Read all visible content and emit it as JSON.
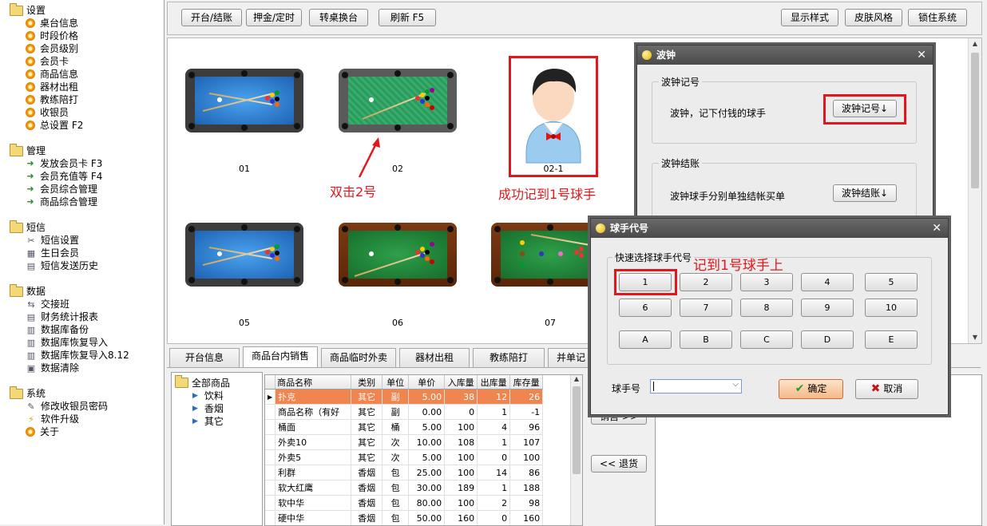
{
  "sidebar": {
    "groups": [
      {
        "label": "设置",
        "items": [
          "桌台信息",
          "时段价格",
          "会员级别",
          "会员卡",
          "商品信息",
          "器材出租",
          "教练陪打",
          "收银员",
          "总设置 F2"
        ]
      },
      {
        "label": "管理",
        "items": [
          "发放会员卡 F3",
          "会员充值等 F4",
          "会员综合管理",
          "商品综合管理"
        ]
      },
      {
        "label": "短信",
        "items": [
          "短信设置",
          "生日会员",
          "短信发送历史"
        ]
      },
      {
        "label": "数据",
        "items": [
          "交接班",
          "财务统计报表",
          "数据库备份",
          "数据库恢复导入",
          "数据库恢复导入8.12",
          "数据清除"
        ]
      },
      {
        "label": "系统",
        "items": [
          "修改收银员密码",
          "软件升级",
          "关于"
        ]
      }
    ]
  },
  "toolbar": {
    "open_close": "开台/结账",
    "deposit_timer": "押金/定时",
    "change_table": "转桌换台",
    "refresh": "刷新 F5",
    "display_style": "显示样式",
    "skin_style": "皮肤风格",
    "lock_system": "锁住系统"
  },
  "tables": [
    {
      "label": "01"
    },
    {
      "label": "02"
    },
    {
      "label": "02-1"
    },
    {
      "label": "05"
    },
    {
      "label": "06"
    },
    {
      "label": "07"
    }
  ],
  "annotations": {
    "double_click": "双击2号",
    "success": "成功记到1号球手",
    "record_to": "记到1号球手上"
  },
  "tabs": [
    "开台信息",
    "商品台内销售",
    "商品临时外卖",
    "器材出租",
    "教练陪打",
    "并单记"
  ],
  "category_tree": {
    "root": "全部商品",
    "children": [
      "饮料",
      "香烟",
      "其它"
    ]
  },
  "goods_table": {
    "columns": [
      "商品名称",
      "类别",
      "单位",
      "单价",
      "入库量",
      "出库量",
      "库存量"
    ],
    "rows": [
      [
        "扑克",
        "其它",
        "副",
        "5.00",
        "38",
        "12",
        "26"
      ],
      [
        "商品名称（有好",
        "其它",
        "副",
        "0.00",
        "0",
        "1",
        "-1"
      ],
      [
        "桶面",
        "其它",
        "桶",
        "5.00",
        "100",
        "4",
        "96"
      ],
      [
        "外卖10",
        "其它",
        "次",
        "10.00",
        "108",
        "1",
        "107"
      ],
      [
        "外卖5",
        "其它",
        "次",
        "5.00",
        "100",
        "0",
        "100"
      ],
      [
        "利群",
        "香烟",
        "包",
        "25.00",
        "100",
        "14",
        "86"
      ],
      [
        "软大红鹰",
        "香烟",
        "包",
        "30.00",
        "189",
        "1",
        "188"
      ],
      [
        "软中华",
        "香烟",
        "包",
        "80.00",
        "100",
        "2",
        "98"
      ],
      [
        "硬中华",
        "香烟",
        "包",
        "50.00",
        "160",
        "0",
        "160"
      ]
    ]
  },
  "side_buttons": {
    "sell": "销售 >>",
    "return": "<< 退货"
  },
  "bozhong_dialog": {
    "title": "波钟",
    "record_group": "波钟记号",
    "record_desc": "波钟，记下付钱的球手",
    "record_button": "波钟记号↓",
    "settle_group": "波钟结账",
    "settle_desc": "波钟球手分别单独结帐买单",
    "settle_button": "波钟结账↓"
  },
  "player_dialog": {
    "title": "球手代号",
    "quick_group": "快速选择球手代号",
    "keys": [
      "1",
      "2",
      "3",
      "4",
      "5",
      "6",
      "7",
      "8",
      "9",
      "10",
      "A",
      "B",
      "C",
      "D",
      "E"
    ],
    "player_label": "球手号",
    "player_value": "",
    "ok": "确定",
    "cancel": "取消"
  },
  "colors": {
    "annotation_red": "#e3161b",
    "selected_row": "#f08550",
    "blue_felt": "#2a7fd1",
    "green_felt": "#1f8a3a"
  }
}
